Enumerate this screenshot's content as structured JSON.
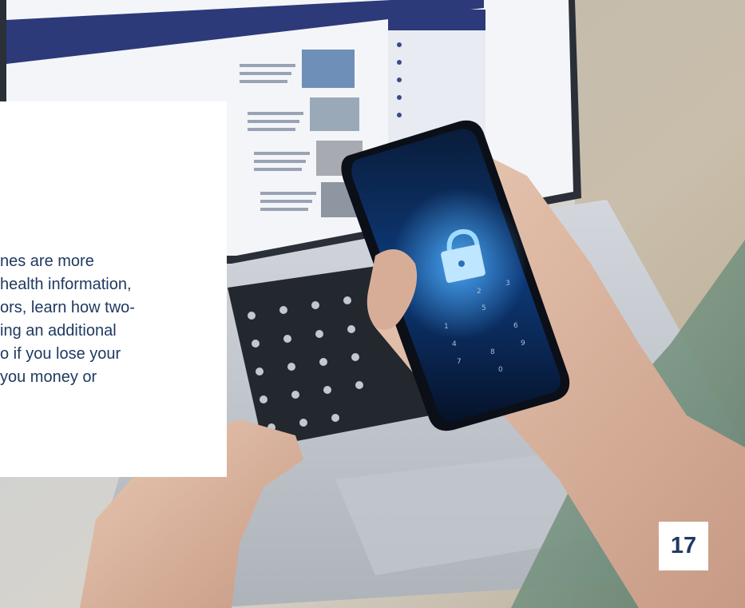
{
  "page": {
    "body_lines": [
      "nes are more",
      "health information,",
      "ors, learn how two-",
      "ing an additional",
      "o if you lose your",
      " you money or"
    ],
    "page_number": "17"
  },
  "photo": {
    "keypad_digits": [
      "1",
      "2",
      "3",
      "4",
      "5",
      "6",
      "7",
      "8",
      "9",
      "0"
    ]
  }
}
